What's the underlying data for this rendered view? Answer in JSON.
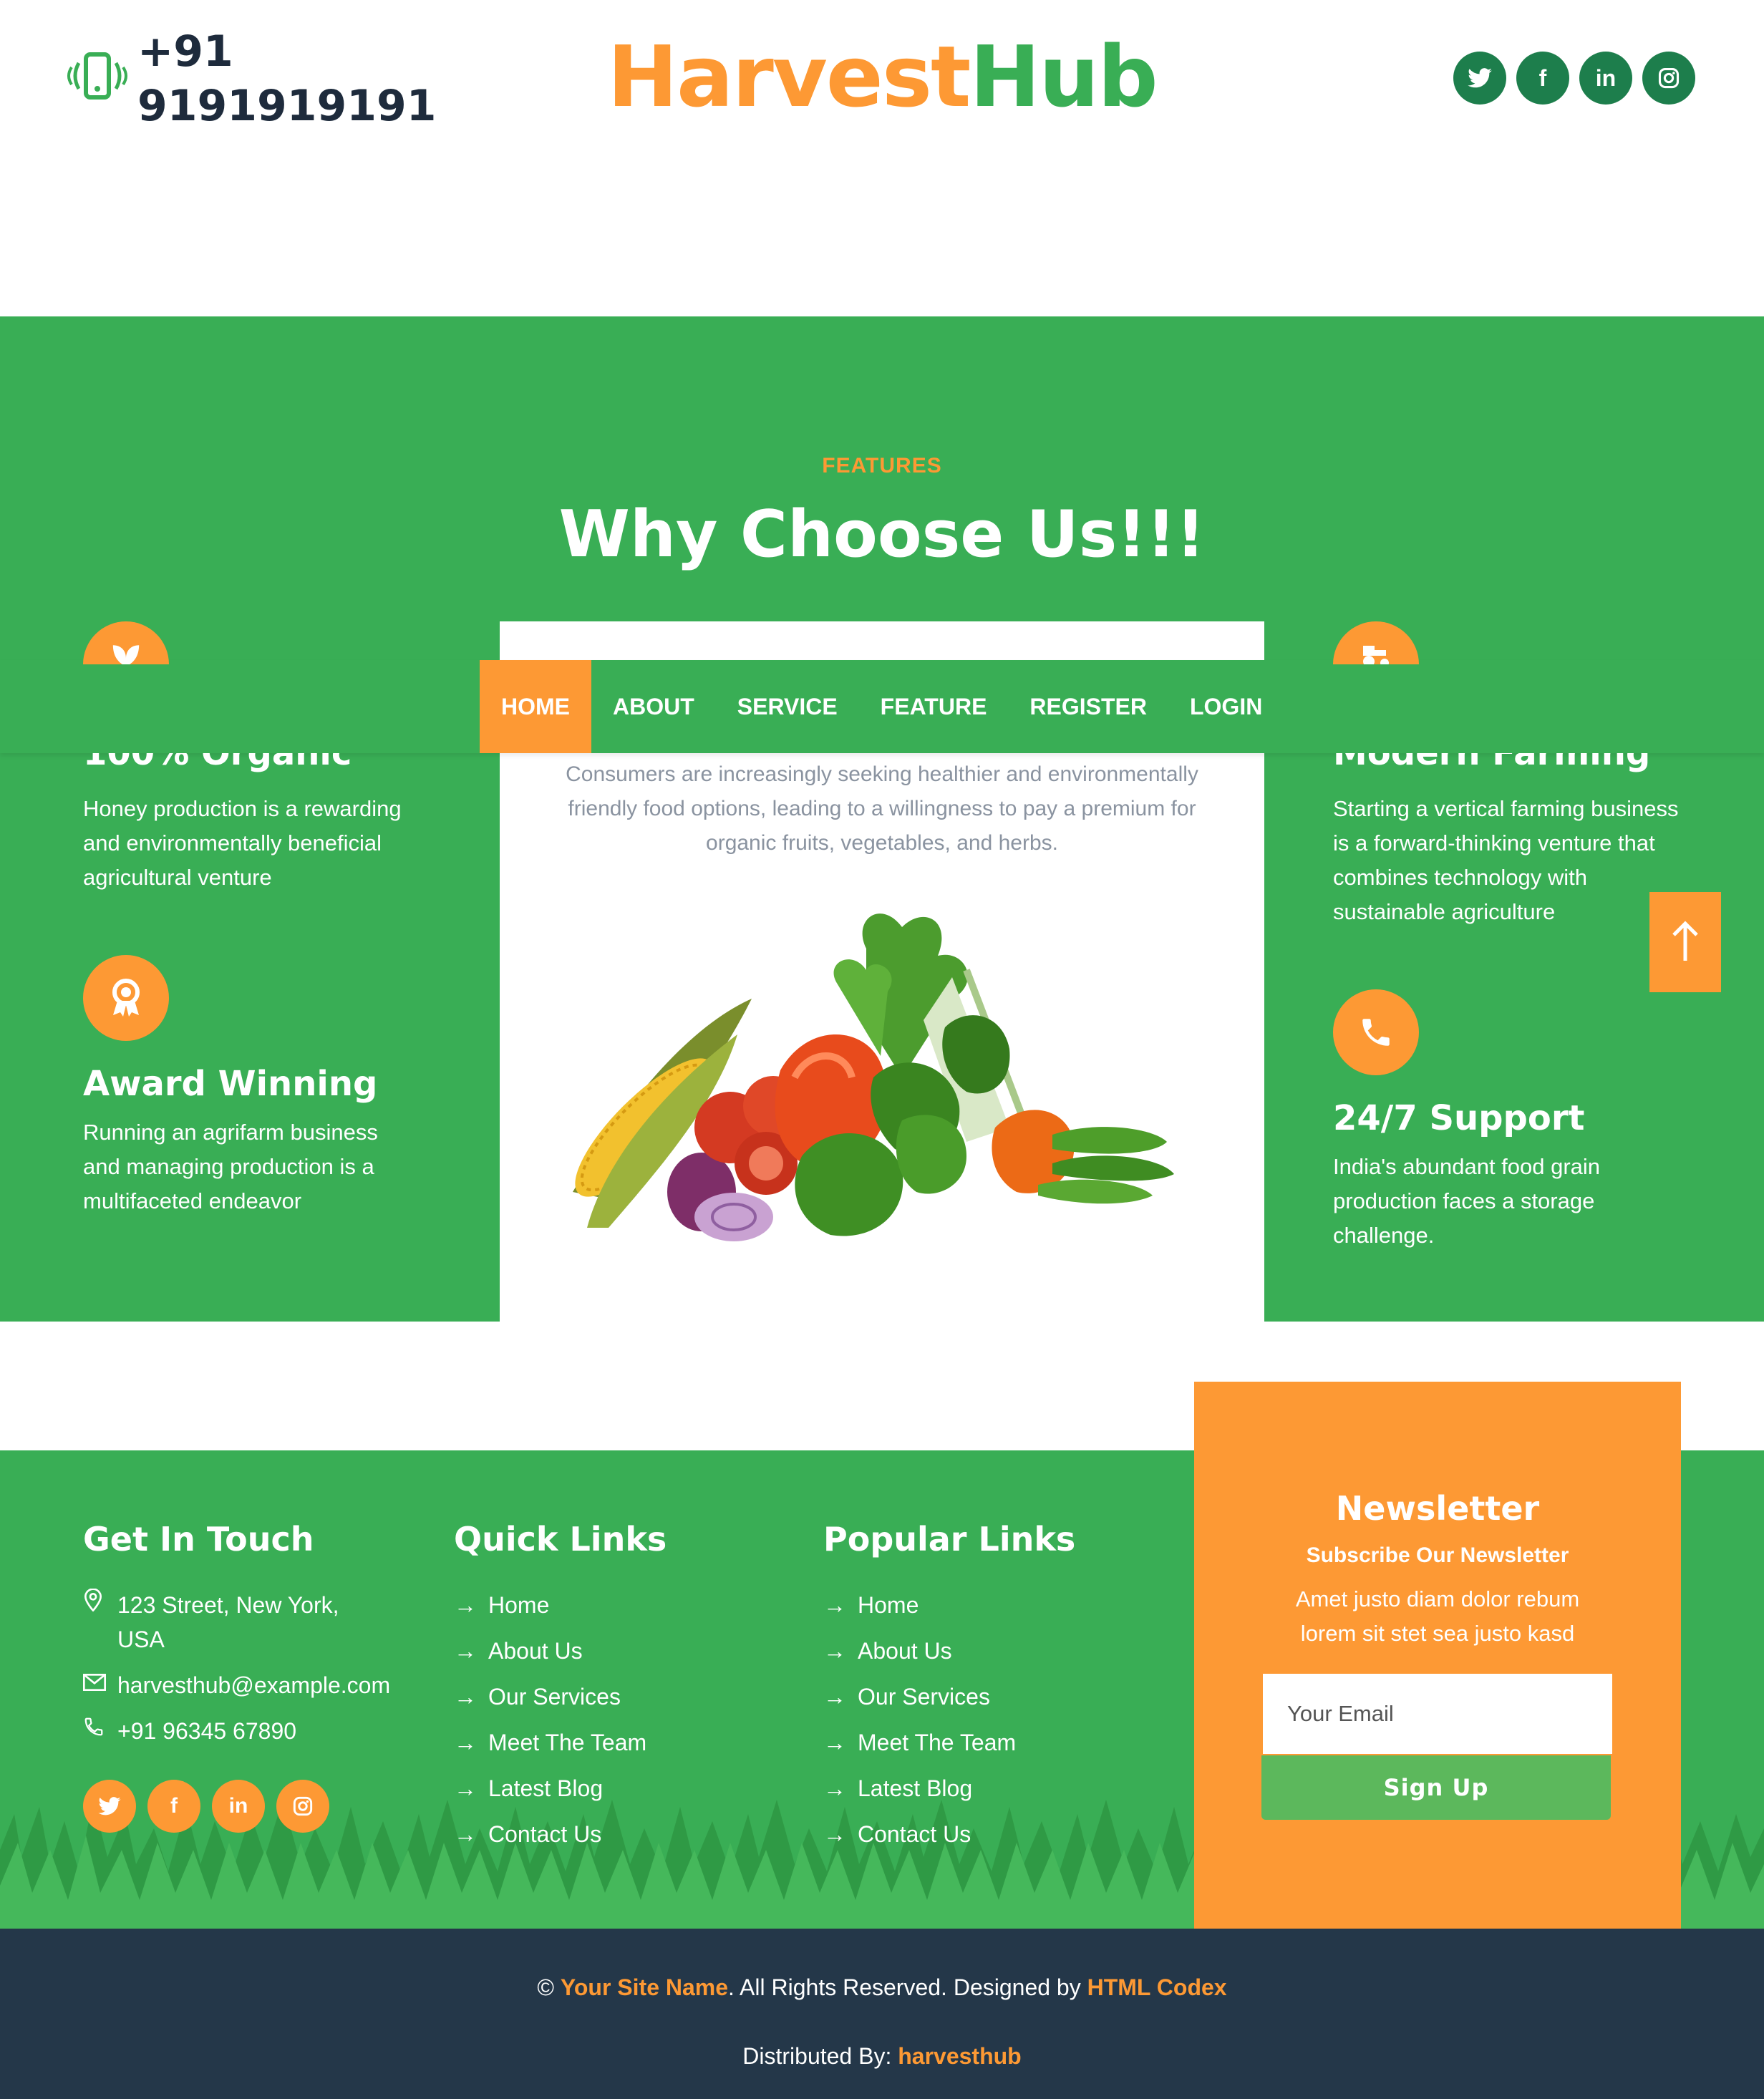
{
  "header": {
    "phone": "+91 9191919191",
    "brand_part1": "Harvest",
    "brand_part2": "Hub",
    "social": [
      "twitter-icon",
      "facebook-icon",
      "linkedin-icon",
      "instagram-icon"
    ]
  },
  "nav": {
    "items": [
      "HOME",
      "ABOUT",
      "SERVICE",
      "FEATURE",
      "REGISTER",
      "LOGIN"
    ],
    "active": "HOME"
  },
  "features": {
    "subtitle": "FEATURES",
    "title": "Why Choose Us!!!",
    "left": [
      {
        "title": "100% Organic",
        "desc": "Honey production is a rewarding and environmentally beneficial agricultural venture",
        "icon": "leaf-icon"
      },
      {
        "title": "Award Winning",
        "desc": "Running an agrifarm business and managing production is a multifaceted endeavor",
        "icon": "award-icon"
      }
    ],
    "right": [
      {
        "title": "Modern Farming",
        "desc": "Starting a vertical farming business is a forward-thinking venture that combines technology with sustainable agriculture",
        "icon": "tractor-icon"
      },
      {
        "title": "24/7 Support",
        "desc": "India's abundant food grain production faces a storage challenge.",
        "icon": "phone-icon"
      }
    ],
    "card_text": "Consumers are increasingly seeking healthier and environmentally friendly food options, leading to a willingness to pay a premium for organic fruits, vegetables, and herbs."
  },
  "footer": {
    "contact": {
      "title": "Get In Touch",
      "address": "123 Street, New York, USA",
      "email": "harvesthub@example.com",
      "phone": "+91 96345 67890"
    },
    "quick_links": {
      "title": "Quick Links",
      "items": [
        "Home",
        "About Us",
        "Our Services",
        "Meet The Team",
        "Latest Blog",
        "Contact Us"
      ]
    },
    "popular_links": {
      "title": "Popular Links",
      "items": [
        "Home",
        "About Us",
        "Our Services",
        "Meet The Team",
        "Latest Blog",
        "Contact Us"
      ]
    },
    "newsletter": {
      "title": "Newsletter",
      "subtitle": "Subscribe Our Newsletter",
      "text": "Amet justo diam dolor rebum lorem sit stet sea justo kasd",
      "placeholder": "Your Email",
      "button": "Sign Up"
    }
  },
  "copyright": {
    "prefix": "©",
    "site_name": "Your Site Name",
    "middle": ". All Rights Reserved. Designed by",
    "designer": "HTML Codex",
    "distributed_label": "Distributed By:",
    "distributor": "harvesthub"
  },
  "colors": {
    "green": "#39ae55",
    "orange": "#fd9934",
    "dark_green": "#1d7e4c",
    "navy": "#243749"
  }
}
